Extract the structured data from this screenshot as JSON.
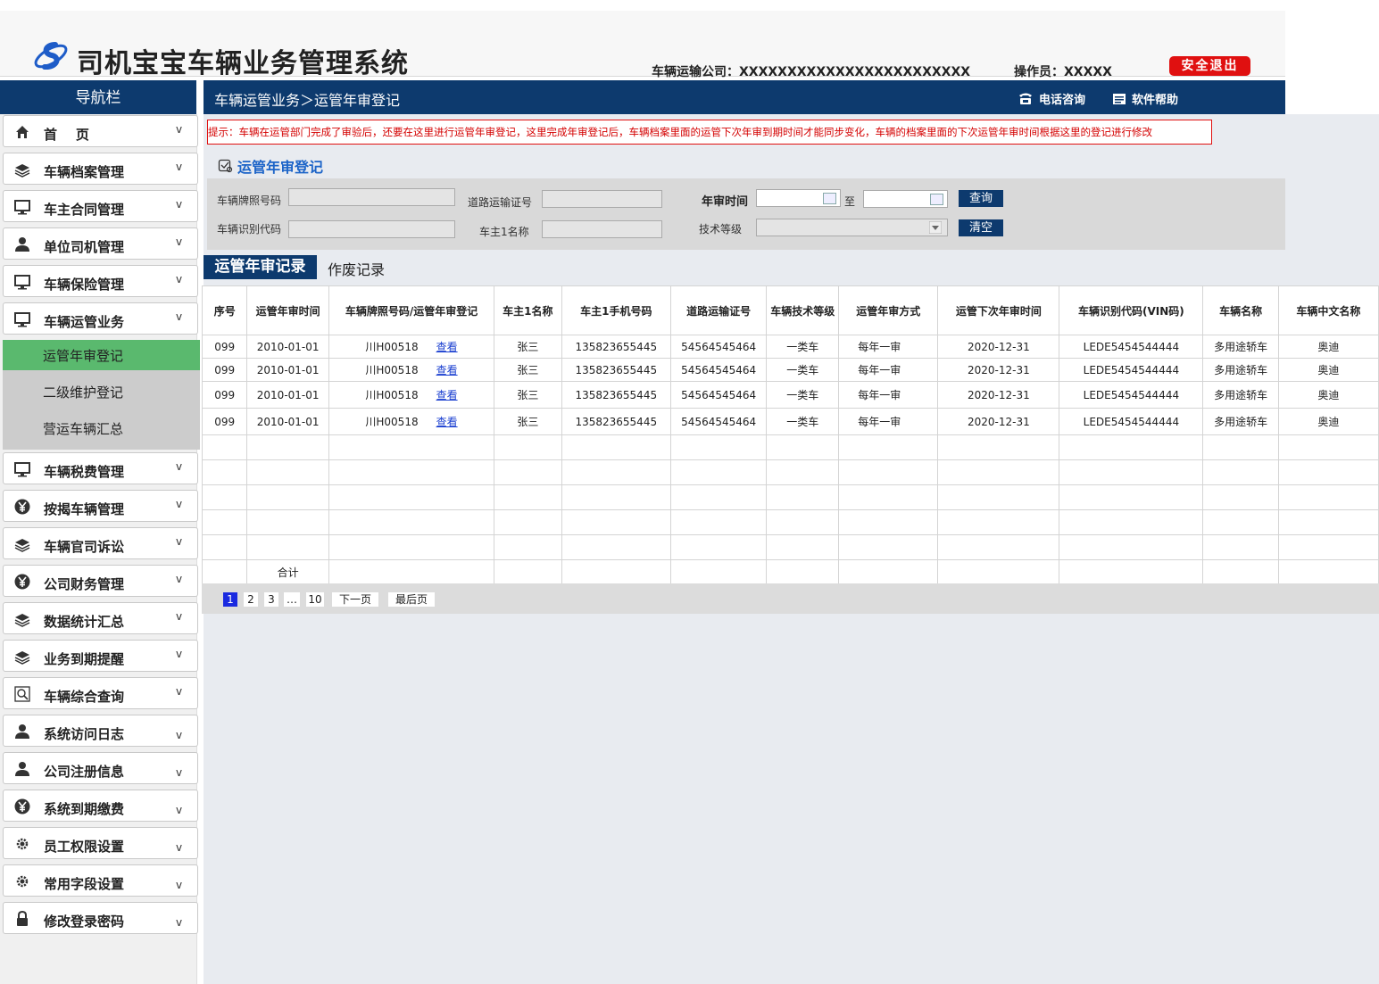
{
  "header": {
    "title": "司机宝宝车辆业务管理系统",
    "company": "车辆运输公司：XXXXXXXXXXXXXXXXXXXXXXXX",
    "operator": "操作员：XXXXX",
    "logout": "安全退出"
  },
  "nav": {
    "title": "导航栏",
    "items": [
      {
        "label": "首    页",
        "icon": "home-icon"
      },
      {
        "label": "车辆档案管理",
        "icon": "layers-icon"
      },
      {
        "label": "车主合同管理",
        "icon": "monitor-icon"
      },
      {
        "label": "单位司机管理",
        "icon": "user-icon"
      },
      {
        "label": "车辆保险管理",
        "icon": "monitor-icon"
      },
      {
        "label": "车辆运管业务",
        "icon": "monitor-icon"
      },
      {
        "label": "车辆税费管理",
        "icon": "monitor-icon"
      },
      {
        "label": "按揭车辆管理",
        "icon": "yen-icon"
      },
      {
        "label": "车辆官司诉讼",
        "icon": "layers-icon"
      },
      {
        "label": "公司财务管理",
        "icon": "yen-icon"
      },
      {
        "label": "数据统计汇总",
        "icon": "layers-icon"
      },
      {
        "label": "业务到期提醒",
        "icon": "layers-icon"
      },
      {
        "label": "车辆综合查询",
        "icon": "search-icon"
      },
      {
        "label": "系统访问日志",
        "icon": "user-icon"
      },
      {
        "label": "公司注册信息",
        "icon": "user-icon"
      },
      {
        "label": "系统到期缴费",
        "icon": "yen-icon"
      },
      {
        "label": "员工权限设置",
        "icon": "gear-icon"
      },
      {
        "label": "常用字段设置",
        "icon": "gear-icon"
      },
      {
        "label": "修改登录密码",
        "icon": "lock-icon"
      }
    ],
    "chevron": "v",
    "sub_items": [
      "运管年审登记",
      "二级维护登记",
      "营运车辆汇总"
    ]
  },
  "topbar": {
    "breadcrumb": "车辆运管业务＞运管年审登记",
    "phone": "电话咨询",
    "help": "软件帮助"
  },
  "tip": "提示：车辆在运管部门完成了审验后，还要在这里进行运管年审登记，这里完成年审登记后，车辆档案里面的运管下次年审到期时间才能同步变化，车辆的档案里面的下次运管年审时间根据这里的登记进行修改",
  "section_title": "运管年审登记",
  "form": {
    "plate_label": "车辆牌照号码",
    "road_label": "道路运输证号",
    "year_label": "年审时间",
    "to_label": "至",
    "vin_label": "车辆识别代码",
    "owner_label": "车主1名称",
    "grade_label": "技术等级",
    "query": "查询",
    "clear": "清空"
  },
  "tabs": {
    "active": "运管年审记录",
    "other": "作废记录"
  },
  "table": {
    "headers": [
      "序号",
      "运管年审时间",
      "车辆牌照号码/运管年审登记",
      "车主1名称",
      "车主1手机号码",
      "道路运输证号",
      "车辆技术等级",
      "运管年审方式",
      "运管下次年审时间",
      "车辆识别代码(VIN码)",
      "车辆名称",
      "车辆中文名称"
    ],
    "rows": [
      {
        "no": "099",
        "date": "2010-01-01",
        "plate": "川H00518",
        "view": "查看",
        "owner": "张三",
        "phone": "135823655445",
        "road": "54564545464",
        "grade": "一类车",
        "mode": "每年一审",
        "next": "2020-12-31",
        "vin": "LEDE5454544444",
        "name": "多用途轿车",
        "cname": "奥迪"
      },
      {
        "no": "099",
        "date": "2010-01-01",
        "plate": "川H00518",
        "view": "查看",
        "owner": "张三",
        "phone": "135823655445",
        "road": "54564545464",
        "grade": "一类车",
        "mode": "每年一审",
        "next": "2020-12-31",
        "vin": "LEDE5454544444",
        "name": "多用途轿车",
        "cname": "奥迪"
      },
      {
        "no": "099",
        "date": "2010-01-01",
        "plate": "川H00518",
        "view": "查看",
        "owner": "张三",
        "phone": "135823655445",
        "road": "54564545464",
        "grade": "一类车",
        "mode": "每年一审",
        "next": "2020-12-31",
        "vin": "LEDE5454544444",
        "name": "多用途轿车",
        "cname": "奥迪"
      },
      {
        "no": "099",
        "date": "2010-01-01",
        "plate": "川H00518",
        "view": "查看",
        "owner": "张三",
        "phone": "135823655445",
        "road": "54564545464",
        "grade": "一类车",
        "mode": "每年一审",
        "next": "2020-12-31",
        "vin": "LEDE5454544444",
        "name": "多用途轿车",
        "cname": "奥迪"
      }
    ],
    "total_label": "合计"
  },
  "pager": {
    "pages": [
      "1",
      "2",
      "3",
      "…",
      "10"
    ],
    "next": "下一页",
    "last": "最后页"
  },
  "colors": {
    "navy": "#0d3a6e",
    "active_green": "#5ab96e",
    "danger": "#e01010",
    "link": "#1a3fd0"
  }
}
